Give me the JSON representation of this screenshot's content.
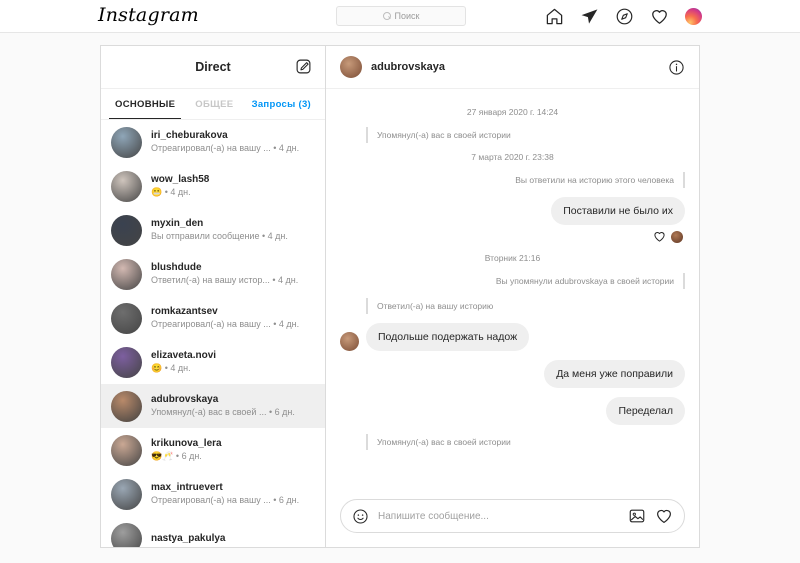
{
  "topnav": {
    "logo": "Instagram",
    "search": {
      "placeholder": "Поиск",
      "icon": "search-icon"
    },
    "icons": [
      "home-icon",
      "send-icon",
      "compass-icon",
      "heart-icon",
      "profile-avatar"
    ]
  },
  "inbox": {
    "title": "Direct",
    "compose_icon": "compose-icon",
    "tabs": [
      {
        "label": "ОСНОВНЫЕ",
        "state": "active"
      },
      {
        "label": "ОБЩЕЕ",
        "state": "muted"
      },
      {
        "label": "Запросы (3)",
        "state": "link"
      }
    ],
    "conversations": [
      {
        "username": "iri_cheburakova",
        "snippet": "Отреагировал(-а) на вашу ... • 4 дн.",
        "avatar": "#8fa6b8"
      },
      {
        "username": "wow_lash58",
        "snippet": "😬 • 4 дн.",
        "avatar": "#cfc5bd"
      },
      {
        "username": "myxin_den",
        "snippet": "Вы отправили сообщение • 4 дн.",
        "avatar": "#3a4250"
      },
      {
        "username": "blushdude",
        "snippet": "Ответил(-а) на вашу истор...  • 4 дн.",
        "avatar": "#d3b9b2"
      },
      {
        "username": "romkazantsev",
        "snippet": "Отреагировал(-а) на вашу ... • 4 дн.",
        "avatar": "#6e6e6e"
      },
      {
        "username": "elizaveta.novi",
        "snippet": "😊 • 4 дн.",
        "avatar": "#7d5fa0"
      },
      {
        "username": "adubrovskaya",
        "snippet": "Упомянул(-а) вас в своей ...  • 6 дн.",
        "avatar": "#b98a6a",
        "selected": true
      },
      {
        "username": "krikunova_lera",
        "snippet": "😎🥂 • 6 дн.",
        "avatar": "#caa894"
      },
      {
        "username": "max_intruevert",
        "snippet": "Отреагировал(-а) на вашу ... • 6 дн.",
        "avatar": "#9aa7b4"
      },
      {
        "username": "nastya_pakulya",
        "snippet": "",
        "avatar": "#9e9e9e"
      }
    ]
  },
  "thread": {
    "username": "adubrovskaya",
    "info_icon": "info-icon",
    "items": [
      {
        "kind": "daystamp",
        "text": "27 января 2020 г. 14:24"
      },
      {
        "kind": "quote",
        "side": "in",
        "text": "Упомянул(-а) вас в своей истории"
      },
      {
        "kind": "daystamp",
        "text": "7 марта 2020 г. 23:38"
      },
      {
        "kind": "quote",
        "side": "out",
        "text": "Вы ответили на историю этого человека"
      },
      {
        "kind": "bubble",
        "side": "out",
        "text": "Поставили не было их"
      },
      {
        "kind": "reaction",
        "icon": "heart-icon"
      },
      {
        "kind": "daystamp",
        "text": "Вторник 21:16"
      },
      {
        "kind": "quote",
        "side": "out",
        "text": "Вы упомянули adubrovskaya в своей истории"
      },
      {
        "kind": "quote",
        "side": "in",
        "text": "Ответил(-а) на вашу историю"
      },
      {
        "kind": "bubble",
        "side": "in",
        "text": "Подольше подержать надож"
      },
      {
        "kind": "bubble",
        "side": "out",
        "text": "Да меня уже поправили"
      },
      {
        "kind": "bubble",
        "side": "out",
        "text": "Переделал"
      },
      {
        "kind": "quote",
        "side": "in",
        "text": "Упомянул(-а) вас в своей истории"
      }
    ],
    "composer": {
      "emoji_icon": "smiley-icon",
      "placeholder": "Напишите сообщение...",
      "image_icon": "image-icon",
      "heart_icon": "heart-icon"
    }
  },
  "colors": {
    "accent": "#0095f6",
    "text": "#262626",
    "muted": "#8e8e8e",
    "bubble": "#efefef",
    "border": "#dbdbdb",
    "page_bg": "#fafafa"
  }
}
